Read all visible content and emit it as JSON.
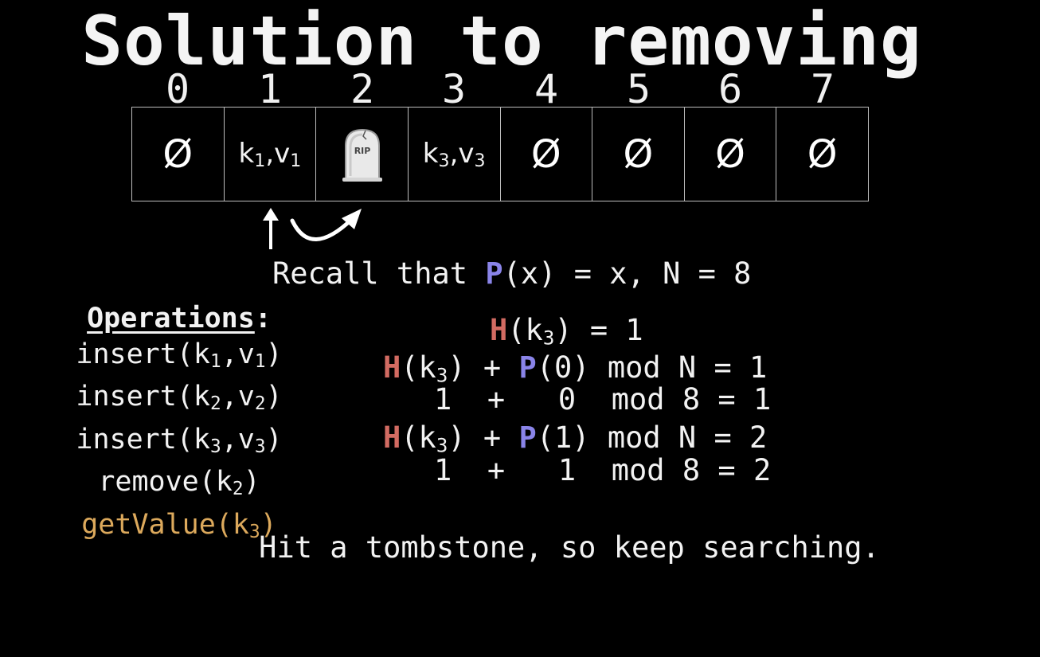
{
  "title": "Solution to removing",
  "table": {
    "indices": [
      "0",
      "1",
      "2",
      "3",
      "4",
      "5",
      "6",
      "7"
    ],
    "empty_symbol": "Ø",
    "cells": [
      {
        "type": "empty"
      },
      {
        "type": "kv",
        "k": "k",
        "ks": "1",
        "v": "v",
        "vs": "1"
      },
      {
        "type": "tombstone",
        "label": "RIP"
      },
      {
        "type": "kv",
        "k": "k",
        "ks": "3",
        "v": "v",
        "vs": "3"
      },
      {
        "type": "empty"
      },
      {
        "type": "empty"
      },
      {
        "type": "empty"
      },
      {
        "type": "empty"
      }
    ]
  },
  "recall": {
    "prefix": "Recall that ",
    "p": "P",
    "suffix": "(x) = x, N = 8"
  },
  "operations": {
    "header": "Operations",
    "header_colon": ":",
    "items": [
      {
        "fn": "insert(",
        "k": "k",
        "ks": "1",
        "mid": ",",
        "v": "v",
        "vs": "1",
        "end": ")"
      },
      {
        "fn": "insert(",
        "k": "k",
        "ks": "2",
        "mid": ",",
        "v": "v",
        "vs": "2",
        "end": ")"
      },
      {
        "fn": "insert(",
        "k": "k",
        "ks": "3",
        "mid": ",",
        "v": "v",
        "vs": "3",
        "end": ")"
      }
    ],
    "remove": {
      "fn": "remove(",
      "k": "k",
      "ks": "2",
      "end": ")"
    },
    "get": {
      "fn": "getValue(",
      "k": "k",
      "ks": "3",
      "end": ")"
    }
  },
  "equations": {
    "h_line": {
      "h": "H",
      "arg": "(k",
      "sub": "3",
      "rest": ") = 1"
    },
    "probe0": {
      "h": "H",
      "arg": "(k",
      "sub": "3",
      "mid": ") + ",
      "p": "P",
      "rest": "(0) mod N = 1"
    },
    "calc0": "1  +   0  mod 8 = 1",
    "probe1": {
      "h": "H",
      "arg": "(k",
      "sub": "3",
      "mid": ") + ",
      "p": "P",
      "rest": "(1) mod N = 2"
    },
    "calc1": "1  +   1  mod 8 = 2"
  },
  "hint": "Hit a tombstone, so keep searching.",
  "colors": {
    "background": "#000000",
    "text": "#f2f2f2",
    "hash_red": "#d26b62",
    "probe_blue": "#8a84e8",
    "get_gold": "#dca95c",
    "grid": "#bdbdbd"
  }
}
